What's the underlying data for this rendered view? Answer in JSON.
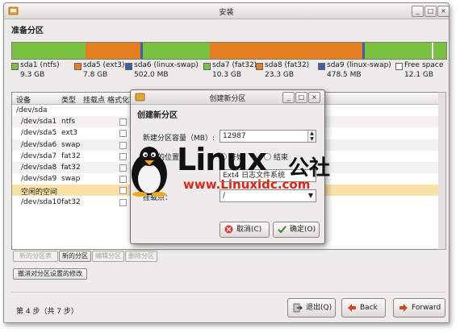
{
  "window": {
    "title": "安装"
  },
  "heading": "准备分区",
  "partition_bar": [
    {
      "color": "#7ac142",
      "fraction": 0.17
    },
    {
      "color": "#e67e22",
      "fraction": 0.125
    },
    {
      "color": "#3f5fa6",
      "fraction": 0.006
    },
    {
      "color": "#7ac142",
      "fraction": 0.155
    },
    {
      "color": "#e67e22",
      "fraction": 0.35
    },
    {
      "color": "#3f5fa6",
      "fraction": 0.006
    },
    {
      "color": "#7ac142",
      "fraction": 0.155
    },
    {
      "color": "#ffffff",
      "fraction": 0.003
    },
    {
      "color": "#7ac142",
      "fraction": 0.03
    }
  ],
  "legend": [
    {
      "name": "sda1 (ntfs)",
      "size": "9.3 GB",
      "color": "#7ac142"
    },
    {
      "name": "sda5 (ext3)",
      "size": "7.8 GB",
      "color": "#e67e22"
    },
    {
      "name": "sda6 (linux-swap)",
      "size": "502.0 MB",
      "color": "#3f5fa6"
    },
    {
      "name": "sda7 (fat32)",
      "size": "10.3 GB",
      "color": "#7ac142"
    },
    {
      "name": "sda8 (fat32)",
      "size": "23.3 GB",
      "color": "#e67e22"
    },
    {
      "name": "sda9 (linux-swap)",
      "size": "478.5 MB",
      "color": "#3f5fa6"
    },
    {
      "name": "Free space",
      "size": "12.1 GB",
      "color": "#ffffff"
    }
  ],
  "table": {
    "headers": [
      "设备",
      "类型",
      "挂载点",
      "格式化？"
    ],
    "rows": [
      {
        "device": "/dev/sda",
        "type": "",
        "checkbox": false
      },
      {
        "device": "/dev/sda1",
        "type": "ntfs",
        "checkbox": true
      },
      {
        "device": "/dev/sda5",
        "type": "ext3",
        "checkbox": true
      },
      {
        "device": "/dev/sda6",
        "type": "swap",
        "checkbox": true
      },
      {
        "device": "/dev/sda7",
        "type": "fat32",
        "checkbox": true
      },
      {
        "device": "/dev/sda8",
        "type": "fat32",
        "checkbox": true
      },
      {
        "device": "/dev/sda9",
        "type": "swap",
        "checkbox": true
      },
      {
        "device": "空闲的空间",
        "type": "",
        "checkbox": true
      },
      {
        "device": "/dev/sda10",
        "type": "fat32",
        "checkbox": true
      }
    ]
  },
  "actions": {
    "new_table": "新的分区表",
    "new_partition": "新的分区",
    "edit_partition": "编辑分区",
    "delete_partition": "删除分区",
    "undo": "撤消对分区设置的修改"
  },
  "footer": {
    "step": "第 4 步（共 7 步）",
    "quit": "退出(Q)",
    "back": "Back",
    "forward": "Forward"
  },
  "dialog": {
    "title": "创建新分区",
    "heading": "创建新分区",
    "size_label": "新建分区容量（MB）:",
    "size_value": "12987",
    "location_label": "分区的位置：",
    "opt_begin": "开始",
    "opt_end": "结束",
    "use_as_value": "Ext4 日志文件系统",
    "mount_label": "挂载点：",
    "mount_value": "/",
    "cancel": "取消(C)",
    "ok": "确定(O)"
  },
  "watermark": {
    "brand": "Linux",
    "cn": "公社",
    "url": "www.Linuxidc.com"
  },
  "colors": {
    "selected_row": "#f9e2a8",
    "accent_green": "#7ac142",
    "accent_orange": "#e67e22"
  }
}
